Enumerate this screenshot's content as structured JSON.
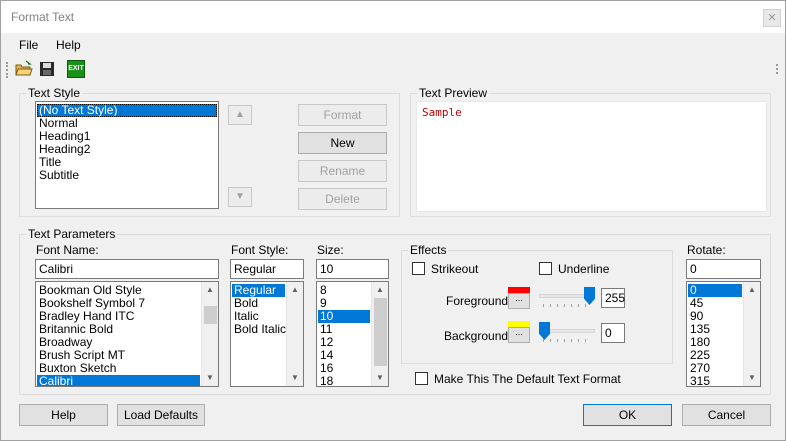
{
  "window": {
    "title": "Format Text"
  },
  "menu": {
    "file": "File",
    "help": "Help"
  },
  "toolbar": {
    "open_icon": "folder-open-icon",
    "save_icon": "floppy-save-icon",
    "exit_label": "EXIT"
  },
  "text_style": {
    "legend": "Text Style",
    "items": [
      "(No Text Style)",
      "Normal",
      "Heading1",
      "Heading2",
      "Title",
      "Subtitle"
    ],
    "selected": 0,
    "buttons": {
      "format": "Format",
      "new": "New",
      "rename": "Rename",
      "delete": "Delete"
    }
  },
  "text_preview": {
    "legend": "Text Preview",
    "sample": "Sample",
    "sample_color": "#c00000"
  },
  "text_parameters": {
    "legend": "Text Parameters",
    "font_name": {
      "label": "Font Name:",
      "value": "Calibri",
      "items": [
        "Bookman Old Style",
        "Bookshelf Symbol 7",
        "Bradley Hand ITC",
        "Britannic Bold",
        "Broadway",
        "Brush Script MT",
        "Buxton Sketch",
        "Calibri"
      ],
      "selected": 7
    },
    "font_style": {
      "label": "Font Style:",
      "value": "Regular",
      "items": [
        "Regular",
        "Bold",
        "Italic",
        "Bold Italic"
      ],
      "selected": 0
    },
    "size": {
      "label": "Size:",
      "value": "10",
      "items": [
        "8",
        "9",
        "10",
        "11",
        "12",
        "14",
        "16",
        "18"
      ],
      "selected": 2
    },
    "effects": {
      "legend": "Effects",
      "strikeout": "Strikeout",
      "underline": "Underline",
      "foreground": {
        "label": "Foreground",
        "value": "255",
        "color": "#ff0000",
        "level": 1.0,
        "button": "..."
      },
      "background": {
        "label": "Background",
        "value": "0",
        "color": "#ffff00",
        "level": 0.0,
        "button": "..."
      }
    },
    "default_checkbox": "Make This The Default Text Format",
    "rotate": {
      "label": "Rotate:",
      "value": "0",
      "items": [
        "0",
        "45",
        "90",
        "135",
        "180",
        "225",
        "270",
        "315"
      ],
      "selected": 0
    }
  },
  "footer": {
    "help": "Help",
    "load_defaults": "Load Defaults",
    "ok": "OK",
    "cancel": "Cancel"
  },
  "accent_color": "#0078d7"
}
